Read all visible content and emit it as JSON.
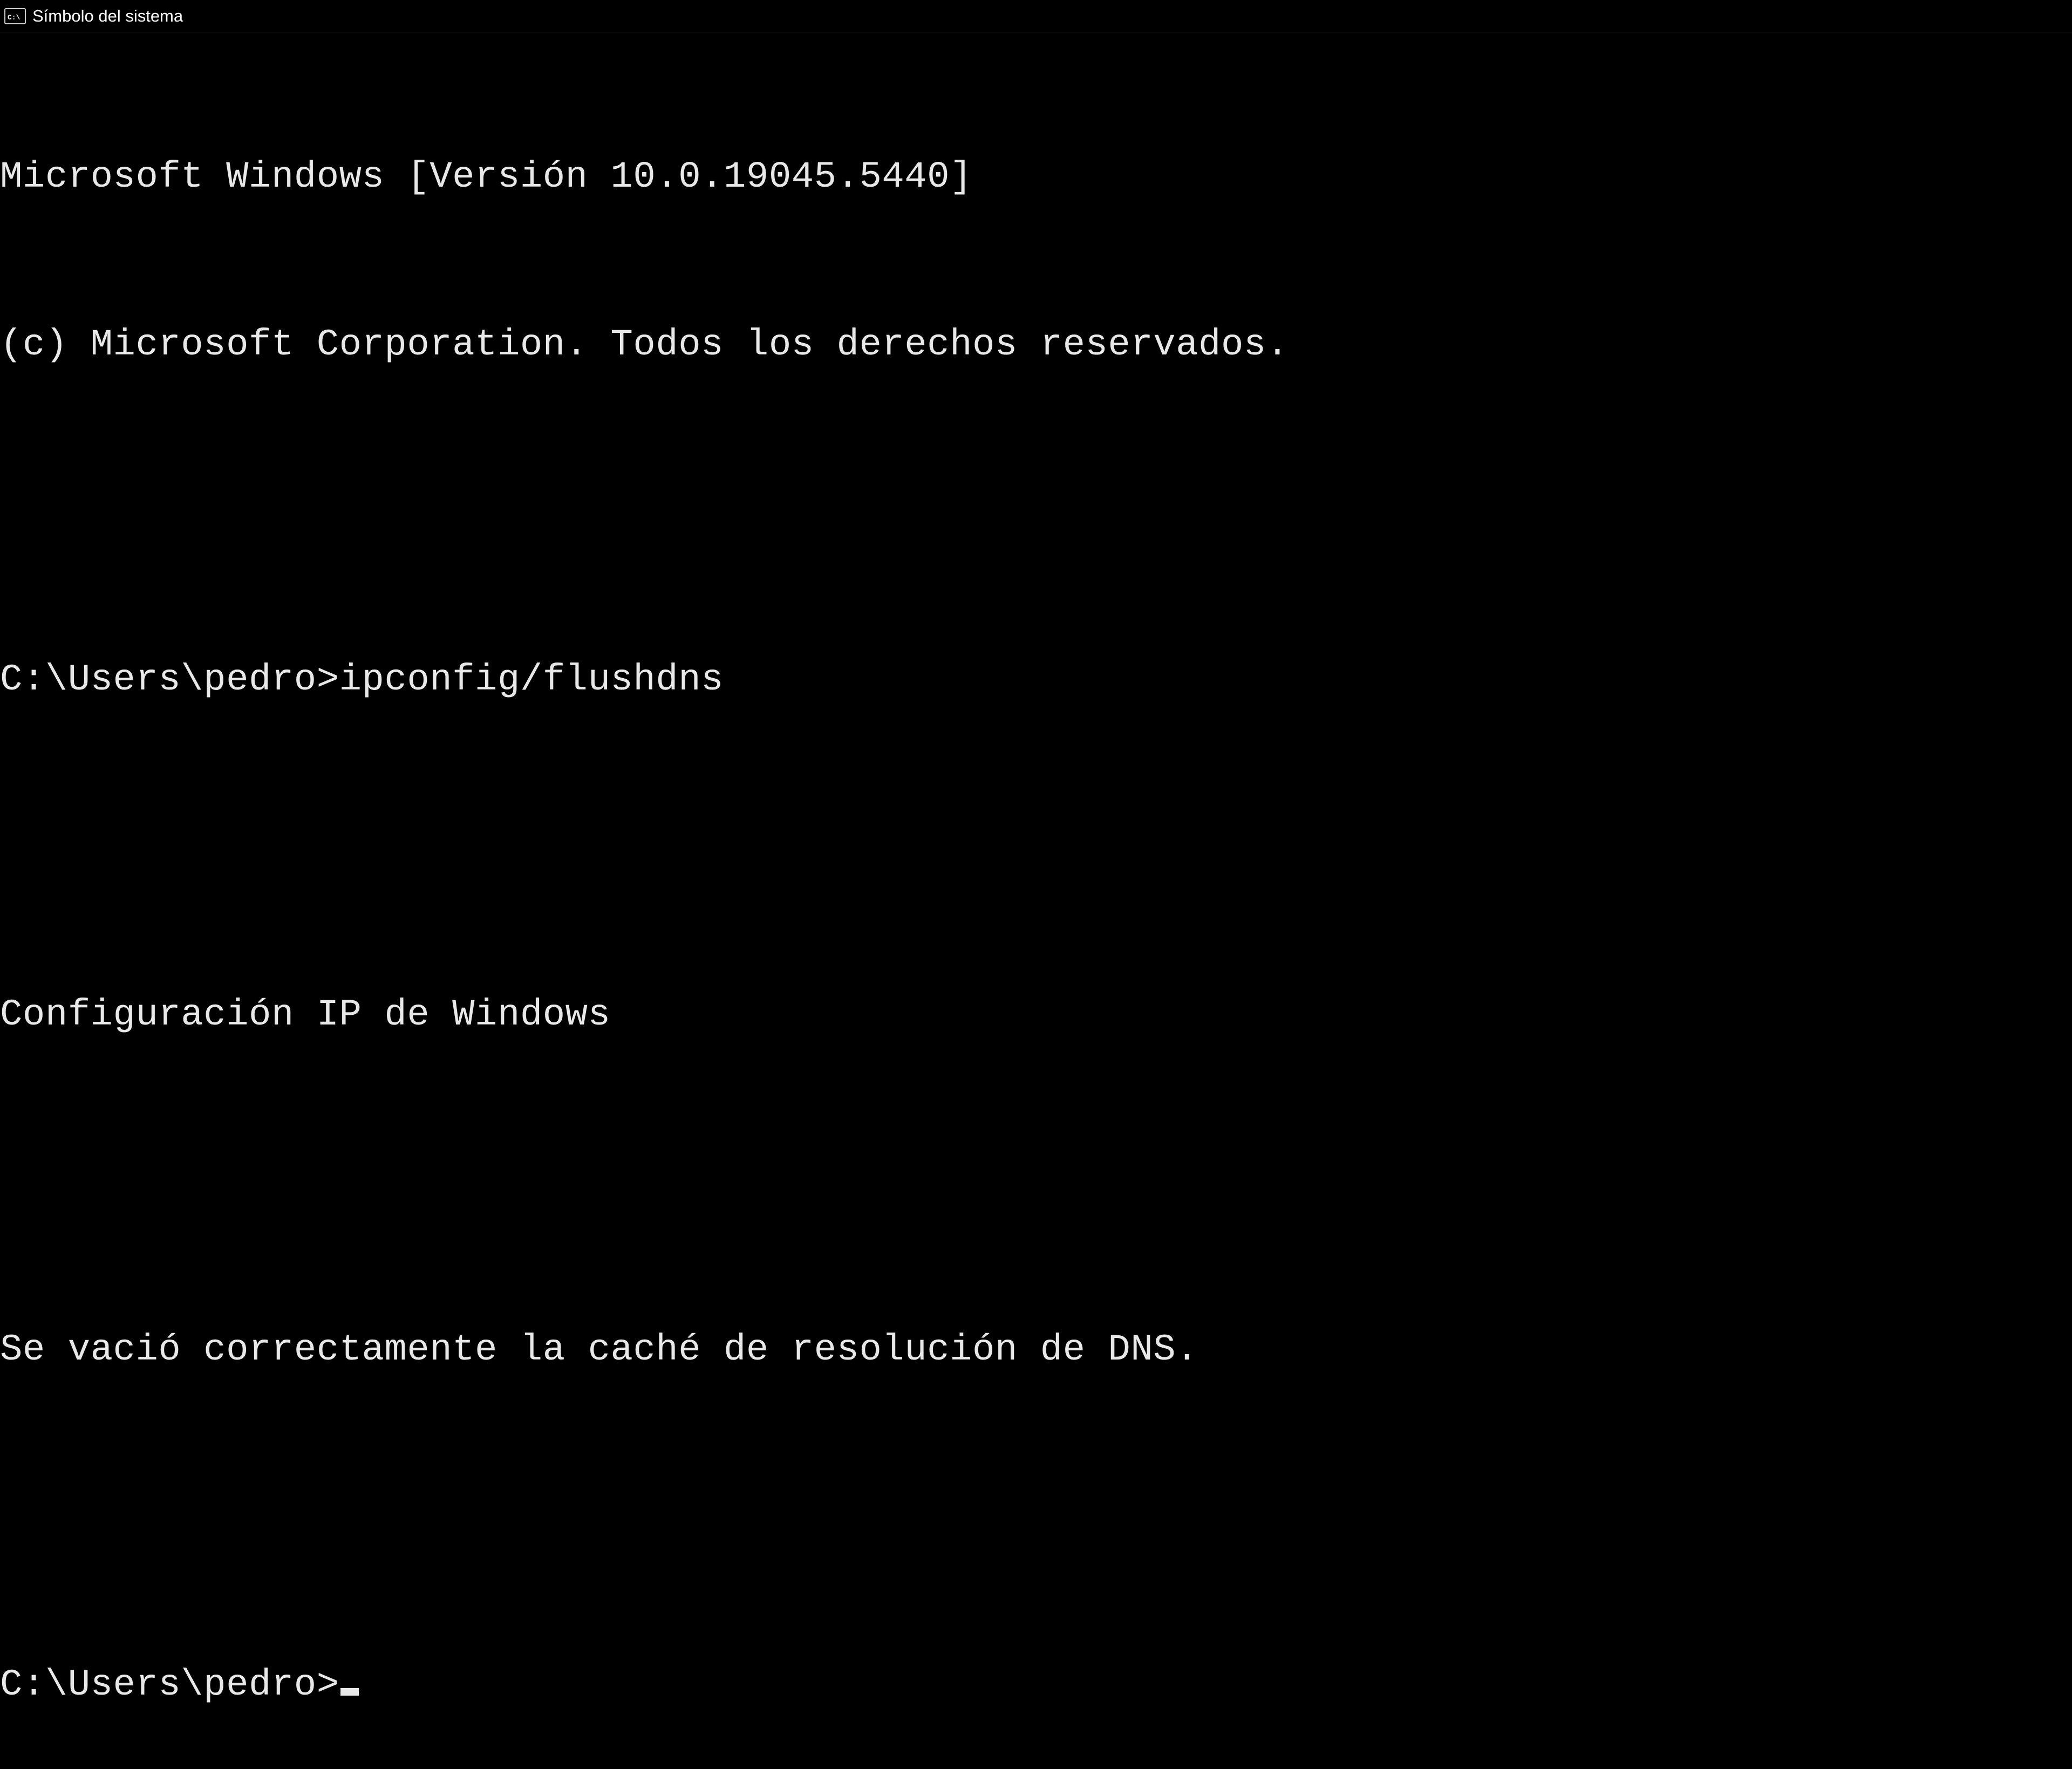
{
  "window": {
    "title": "Símbolo del sistema"
  },
  "terminal": {
    "lines": {
      "version": "Microsoft Windows [Versión 10.0.19045.5440]",
      "copyright": "(c) Microsoft Corporation. Todos los derechos reservados.",
      "blank1": "",
      "command1_prompt": "C:\\Users\\pedro>",
      "command1_text": "ipconfig/flushdns",
      "blank2": "",
      "output_header": "Configuración IP de Windows",
      "blank3": "",
      "output_message": "Se vació correctamente la caché de resolución de DNS.",
      "blank4": "",
      "prompt2": "C:\\Users\\pedro>"
    }
  }
}
